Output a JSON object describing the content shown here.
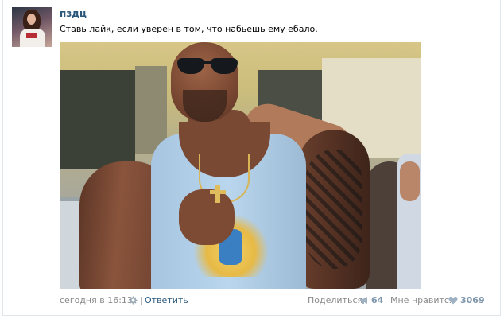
{
  "post": {
    "author": "пздц",
    "text": "Ставь лайк, если уверен в том, что набьешь ему ебало.",
    "photo_alt": "Мужчина в солнцезащитных очках и голубой майке"
  },
  "footer": {
    "date": "сегодня в 16:13",
    "separator": "|",
    "reply_label": "Ответить",
    "share_label": "Поделиться",
    "share_count": "64",
    "like_label": "Мне нравится",
    "like_count": "3069"
  },
  "icons": {
    "settings": "gear-icon",
    "share": "megaphone-icon",
    "like": "heart-icon"
  },
  "colors": {
    "link": "#2b587a",
    "muted": "#8a8a8a",
    "count": "#7f97ad",
    "border": "#e1e6ea"
  }
}
